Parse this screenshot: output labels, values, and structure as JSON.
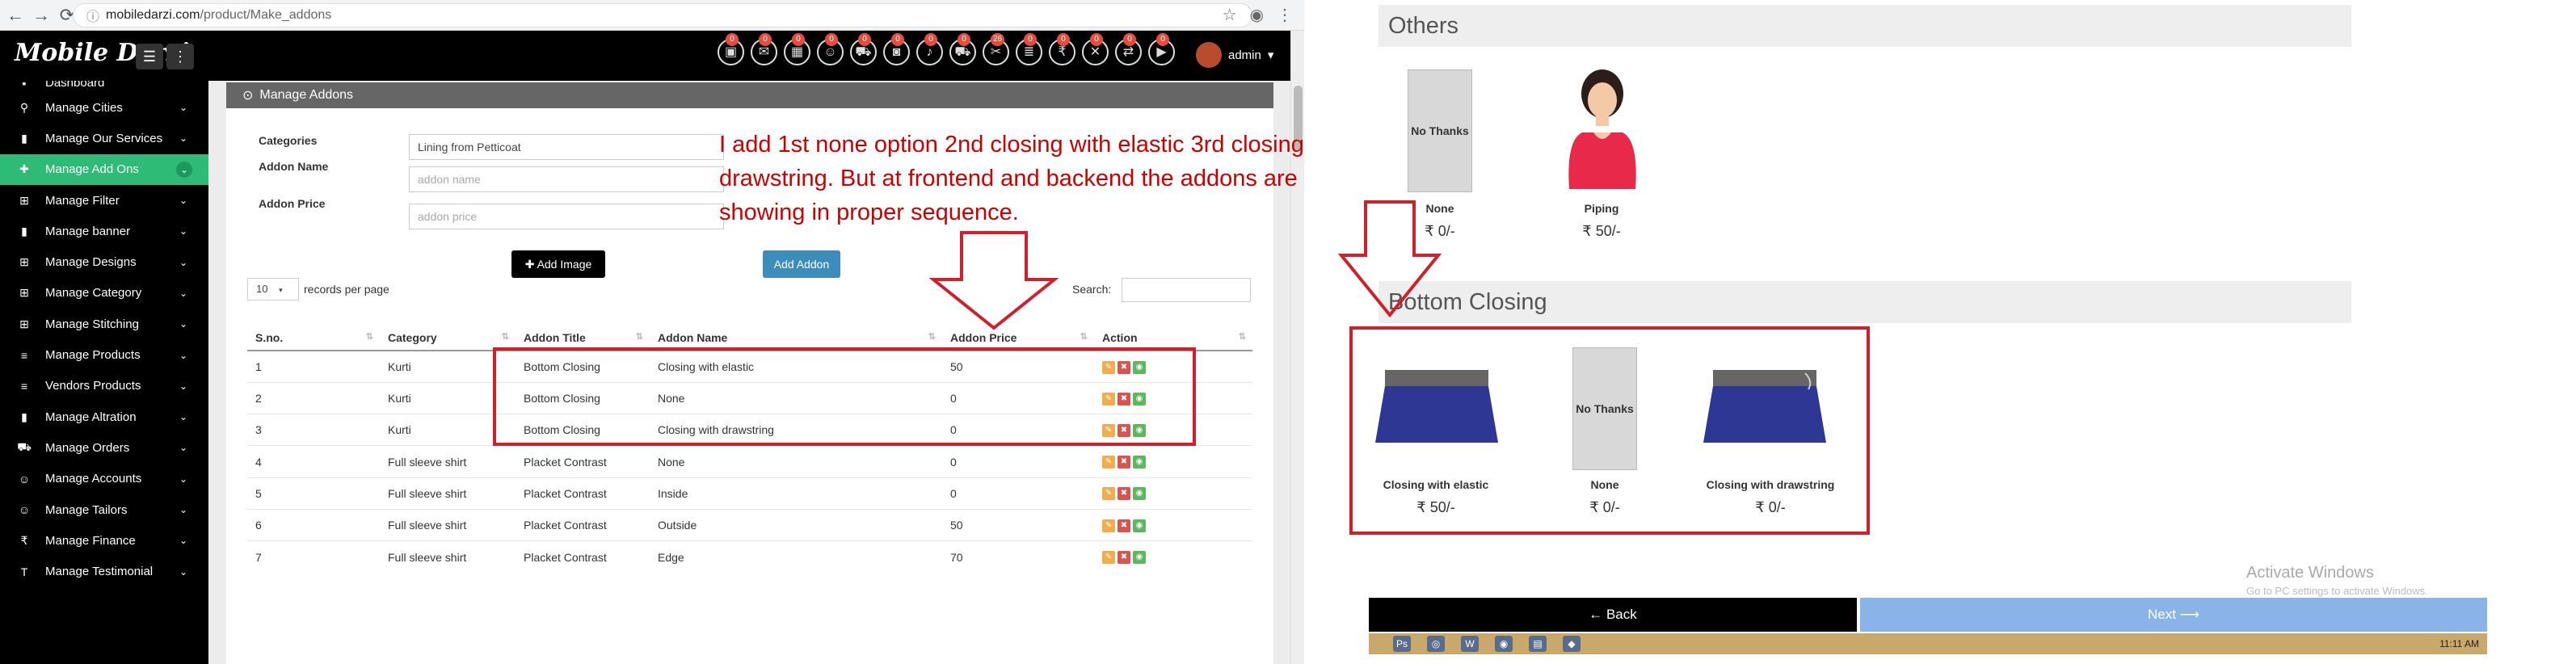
{
  "browser": {
    "url_domain": "mobiledarzi.com",
    "url_path": "/product/Make_addons"
  },
  "header": {
    "logo_text": "Mobile Darzi",
    "user_label": "admin",
    "notification_icons": [
      {
        "icon": "inbox-icon",
        "count": "0"
      },
      {
        "icon": "message-icon",
        "count": "0"
      },
      {
        "icon": "id-card-icon",
        "count": "0"
      },
      {
        "icon": "user-icon",
        "count": "0"
      },
      {
        "icon": "cart-icon",
        "count": "0"
      },
      {
        "icon": "camera-icon",
        "count": "0"
      },
      {
        "icon": "bell-icon",
        "count": "0"
      },
      {
        "icon": "truck-icon",
        "count": "0"
      },
      {
        "icon": "scissors-icon",
        "count": "26"
      },
      {
        "icon": "list-icon",
        "count": "0"
      },
      {
        "icon": "money-icon",
        "count": "0"
      },
      {
        "icon": "close-icon",
        "count": "0"
      },
      {
        "icon": "exchange-icon",
        "count": "0"
      },
      {
        "icon": "video-icon",
        "count": "0"
      }
    ]
  },
  "sidebar": {
    "top_partial": "Dashboard",
    "items": [
      {
        "label": "Manage Cities",
        "icon": "map-marker-icon"
      },
      {
        "label": "Manage Our Services",
        "icon": "bookmark-icon"
      },
      {
        "label": "Manage Add Ons",
        "icon": "plus-icon",
        "active": true
      },
      {
        "label": "Manage Filter",
        "icon": "sitemap-icon"
      },
      {
        "label": "Manage banner",
        "icon": "bookmark-icon"
      },
      {
        "label": "Manage Designs",
        "icon": "sitemap-icon"
      },
      {
        "label": "Manage Category",
        "icon": "sitemap-icon"
      },
      {
        "label": "Manage Stitching",
        "icon": "sitemap-icon"
      },
      {
        "label": "Manage Products",
        "icon": "database-icon"
      },
      {
        "label": "Vendors Products",
        "icon": "database-icon"
      },
      {
        "label": "Manage Altration",
        "icon": "bookmark-icon"
      },
      {
        "label": "Manage Orders",
        "icon": "cart-icon"
      },
      {
        "label": "Manage Accounts",
        "icon": "user-plus-icon"
      },
      {
        "label": "Manage Tailors",
        "icon": "user-plus-icon"
      },
      {
        "label": "Manage Finance",
        "icon": "rupee-icon"
      },
      {
        "label": "Manage Testimonial",
        "icon": "text-icon"
      }
    ]
  },
  "form": {
    "panel_title": "Manage Addons",
    "categories_label": "Categories",
    "categories_value": "Lining from Petticoat",
    "addon_name_label": "Addon Name",
    "addon_name_placeholder": "addon name",
    "addon_price_label": "Addon Price",
    "addon_price_placeholder": "addon price",
    "add_image_button": "Add Image",
    "add_addon_button": "Add Addon"
  },
  "table_controls": {
    "page_length": "10",
    "records_per_page": "records per page",
    "search_label": "Search:"
  },
  "table": {
    "columns": [
      "S.no.",
      "Category",
      "Addon Title",
      "Addon Name",
      "Addon Price",
      "Action"
    ],
    "rows": [
      [
        "1",
        "Kurti",
        "Bottom Closing",
        "Closing with elastic",
        "50"
      ],
      [
        "2",
        "Kurti",
        "Bottom Closing",
        "None",
        "0"
      ],
      [
        "3",
        "Kurti",
        "Bottom Closing",
        "Closing with drawstring",
        "0"
      ],
      [
        "4",
        "Full sleeve shirt",
        "Placket Contrast",
        "None",
        "0"
      ],
      [
        "5",
        "Full sleeve shirt",
        "Placket Contrast",
        "Inside",
        "0"
      ],
      [
        "6",
        "Full sleeve shirt",
        "Placket Contrast",
        "Outside",
        "50"
      ],
      [
        "7",
        "Full sleeve shirt",
        "Placket Contrast",
        "Edge",
        "70"
      ]
    ]
  },
  "annotation": {
    "text": "I add 1st none option 2nd closing with elastic 3rd closing with drawstring. But at frontend and backend the addons are not showing in  proper sequence."
  },
  "frontend": {
    "others_title": "Others",
    "others_items": [
      {
        "label": "None",
        "price": "₹ 0/-",
        "thumb_text": "No Thanks"
      },
      {
        "label": "Piping",
        "price": "₹ 50/-"
      }
    ],
    "bottom_closing_title": "Bottom Closing",
    "bottom_items": [
      {
        "label": "Closing with elastic",
        "price": "₹ 50/-"
      },
      {
        "label": "None",
        "price": "₹ 0/-",
        "thumb_text": "No Thanks"
      },
      {
        "label": "Closing with drawstring",
        "price": "₹ 0/-"
      }
    ],
    "back_button": "← Back",
    "next_button": "Next ⟶"
  },
  "windows": {
    "activate_title": "Activate Windows",
    "activate_sub": "Go to PC settings to activate Windows.",
    "clock": "11:11 AM"
  },
  "colors": {
    "active_menu": "#2dbb76",
    "annotation_red": "#d0202c",
    "add_addon_blue": "#3c8dbc",
    "skirt_blue": "#2e3794"
  }
}
